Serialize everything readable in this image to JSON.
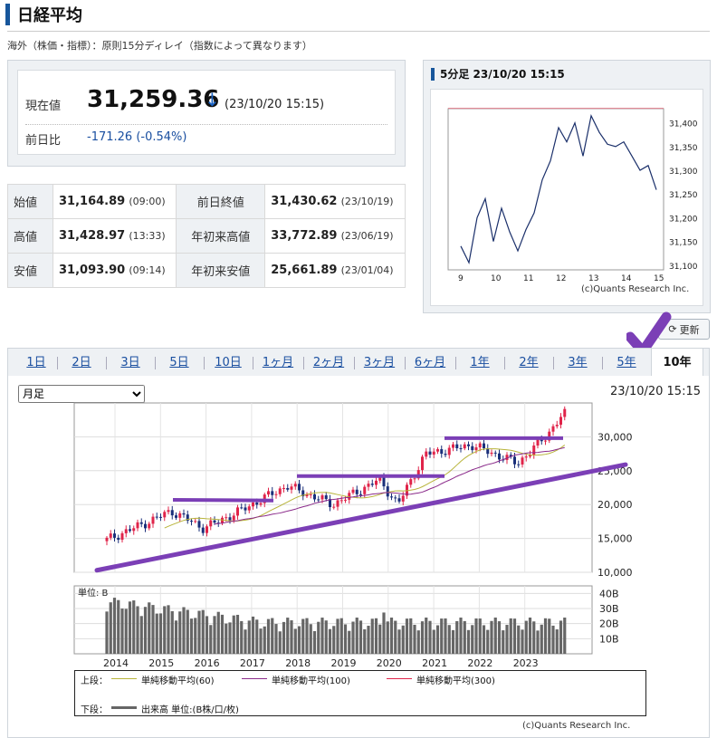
{
  "title": "日経平均",
  "note": "海外（株価・指標）：原則15分ディレイ（指数によって異なります）",
  "quote": {
    "current_label": "現在値",
    "price": "31,259.36",
    "arrow": "↓",
    "time": "(23/10/20 15:15)",
    "change_label": "前日比",
    "change": "-171.26",
    "change_pct": "(-0.54%)"
  },
  "ohlc": {
    "open_label": "始値",
    "open": "31,164.89",
    "open_time": "(09:00)",
    "prev_label": "前日終値",
    "prev": "31,430.62",
    "prev_time": "(23/10/19)",
    "high_label": "高値",
    "high": "31,428.97",
    "high_time": "(13:33)",
    "ytd_high_label": "年初来高値",
    "ytd_high": "33,772.89",
    "ytd_high_time": "(23/06/19)",
    "low_label": "安値",
    "low": "31,093.90",
    "low_time": "(09:14)",
    "ytd_low_label": "年初来安値",
    "ytd_low": "25,661.89",
    "ytd_low_time": "(23/01/04)"
  },
  "mini_chart": {
    "header": "5分足 23/10/20 15:15",
    "credit": "(c)Quants Research Inc.",
    "x_ticks": [
      "9",
      "10",
      "11",
      "12",
      "13",
      "14",
      "15"
    ],
    "y_ticks": [
      "31,400",
      "31,350",
      "31,300",
      "31,250",
      "31,200",
      "31,150",
      "31,100"
    ]
  },
  "refresh_label": "更新",
  "tabs": [
    "1日",
    "2日",
    "3日",
    "5日",
    "10日",
    "1ヶ月",
    "2ヶ月",
    "3ヶ月",
    "6ヶ月",
    "1年",
    "2年",
    "3年",
    "5年",
    "10年"
  ],
  "active_tab": "10年",
  "period_select": "月足",
  "chart_time": "23/10/20 15:15",
  "volume_unit": "単位: B",
  "legend": {
    "upper_label": "上段：",
    "ma60": "単純移動平均(60)",
    "ma100": "単純移動平均(100)",
    "ma300": "単純移動平均(300)",
    "lower_label": "下段：",
    "volume": "出来高 単位:(B株/口/枚)"
  },
  "chart_credit": "(c)Quants Research Inc.",
  "colors": {
    "up": "#e0244a",
    "down": "#1a2f7a",
    "ma60": "#b8b43a",
    "ma100": "#8a2a8a",
    "annot": "#7b3fb6"
  },
  "chart_data": [
    {
      "type": "line",
      "title": "5分足 23/10/20 15:15",
      "x": [
        9.0,
        9.25,
        9.5,
        9.75,
        10.0,
        10.25,
        10.5,
        10.75,
        11.0,
        11.25,
        11.5,
        11.75,
        12.0,
        12.25,
        12.5,
        12.75,
        13.0,
        13.25,
        13.5,
        13.75,
        14.0,
        14.25,
        14.5,
        14.75,
        15.0
      ],
      "y": [
        31140,
        31105,
        31200,
        31240,
        31150,
        31220,
        31170,
        31130,
        31175,
        31210,
        31280,
        31320,
        31390,
        31360,
        31400,
        31330,
        31415,
        31380,
        31355,
        31350,
        31360,
        31330,
        31300,
        31310,
        31259
      ],
      "x_ticks": [
        "9",
        "10",
        "11",
        "12",
        "13",
        "14",
        "15"
      ],
      "ylim": [
        31090,
        31430
      ],
      "y_ticks": [
        31100,
        31150,
        31200,
        31250,
        31300,
        31350,
        31400
      ],
      "reference_line": 31430.62
    },
    {
      "type": "candlestick",
      "title": "10年 月足",
      "x_ticks": [
        "2014",
        "2015",
        "2016",
        "2017",
        "2018",
        "2019",
        "2020",
        "2021",
        "2022",
        "2023"
      ],
      "ylim": [
        10000,
        35000
      ],
      "y_ticks": [
        10000,
        15000,
        20000,
        25000,
        30000
      ],
      "close_by_year": [
        {
          "year": "2014",
          "close": 17451
        },
        {
          "year": "2015",
          "close": 19034
        },
        {
          "year": "2016",
          "close": 19114
        },
        {
          "year": "2017",
          "close": 22765
        },
        {
          "year": "2018",
          "close": 20015
        },
        {
          "year": "2019",
          "close": 23657
        },
        {
          "year": "2020",
          "close": 27444
        },
        {
          "year": "2021",
          "close": 28792
        },
        {
          "year": "2022",
          "close": 26095
        },
        {
          "year": "2023",
          "close": 31259
        }
      ],
      "series": [
        {
          "name": "単純移動平均(60)"
        },
        {
          "name": "単純移動平均(100)"
        },
        {
          "name": "単純移動平均(300)"
        }
      ],
      "volume": {
        "unit": "単位: B",
        "y_ticks": [
          "40B",
          "30B",
          "20B",
          "10B"
        ],
        "ylim": [
          0,
          45
        ]
      }
    }
  ]
}
